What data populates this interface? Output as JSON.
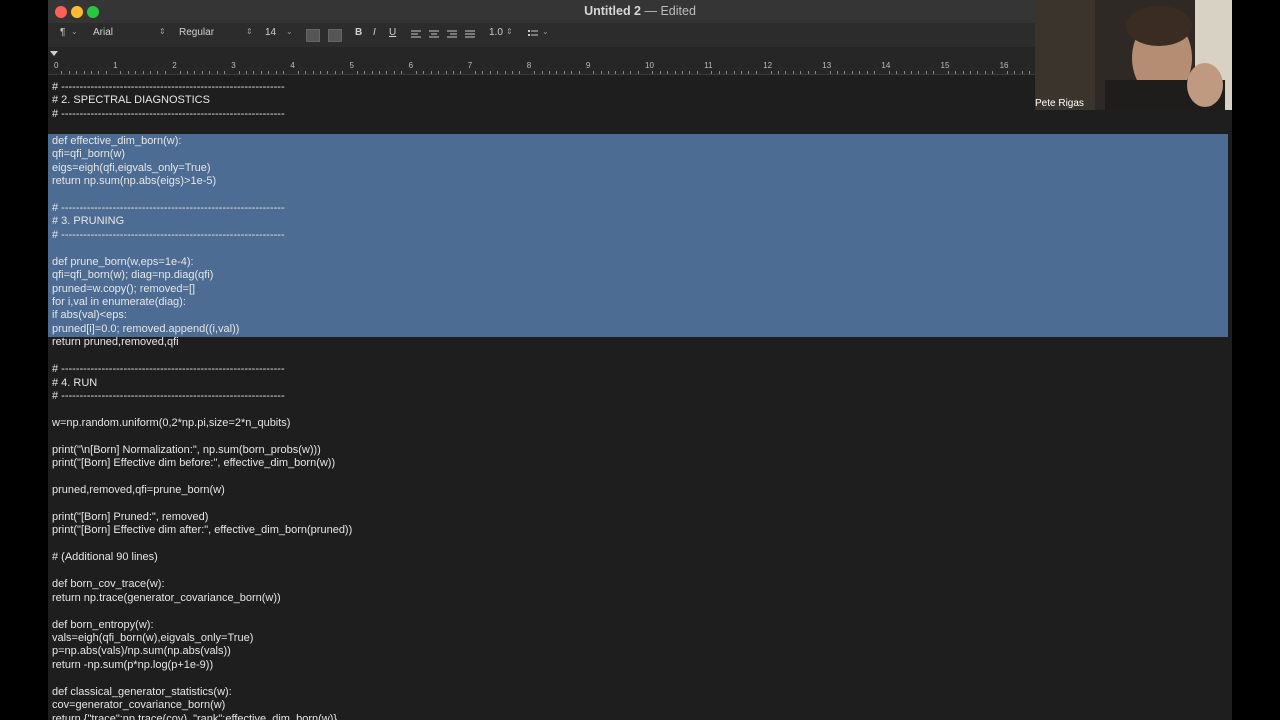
{
  "window": {
    "title": "Untitled 2",
    "subtitle": "— Edited"
  },
  "toolbar": {
    "paragraph_icon": "¶",
    "font_family": "Arial",
    "font_style": "Regular",
    "font_size": "14",
    "bold": "B",
    "italic": "I",
    "underline": "U",
    "line_spacing": "1.0"
  },
  "ruler": {
    "ticks": [
      "0",
      "1",
      "2",
      "3",
      "4",
      "5",
      "6",
      "7",
      "8",
      "9",
      "10",
      "11",
      "12",
      "13",
      "14",
      "15",
      "16"
    ]
  },
  "code_lines": [
    "# -------------------------------------------------------------",
    "# 2. SPECTRAL DIAGNOSTICS",
    "# -------------------------------------------------------------",
    "",
    "def effective_dim_born(w):",
    "qfi=qfi_born(w)",
    "eigs=eigh(qfi,eigvals_only=True)",
    "return np.sum(np.abs(eigs)>1e-5)",
    "",
    "# -------------------------------------------------------------",
    "# 3. PRUNING",
    "# -------------------------------------------------------------",
    "",
    "def prune_born(w,eps=1e-4):",
    "qfi=qfi_born(w); diag=np.diag(qfi)",
    "pruned=w.copy(); removed=[]",
    "for i,val in enumerate(diag):",
    "if abs(val)<eps:",
    "pruned[i]=0.0; removed.append((i,val))",
    "return pruned,removed,qfi",
    "",
    "# -------------------------------------------------------------",
    "# 4. RUN",
    "# -------------------------------------------------------------",
    "",
    "w=np.random.uniform(0,2*np.pi,size=2*n_qubits)",
    "",
    "print(\"\\n[Born] Normalization:\", np.sum(born_probs(w)))",
    "print(\"[Born] Effective dim before:\", effective_dim_born(w))",
    "",
    "pruned,removed,qfi=prune_born(w)",
    "",
    "print(\"[Born] Pruned:\", removed)",
    "print(\"[Born] Effective dim after:\", effective_dim_born(pruned))",
    "",
    "# (Additional 90 lines)",
    "",
    "def born_cov_trace(w):",
    "return np.trace(generator_covariance_born(w))",
    "",
    "def born_entropy(w):",
    "vals=eigh(qfi_born(w),eigvals_only=True)",
    "p=np.abs(vals)/np.sum(np.abs(vals))",
    "return -np.sum(p*np.log(p+1e-9))",
    "",
    "def classical_generator_statistics(w):",
    "cov=generator_covariance_born(w)",
    "return {\"trace\":np.trace(cov), \"rank\":effective_dim_born(w)}"
  ],
  "webcam": {
    "participant_name": "Pete Rigas"
  },
  "colors": {
    "selection": "#4d6c93",
    "background": "#1e1e1e",
    "close": "#fe5f57",
    "minimize": "#febc2e",
    "maximize": "#28c840"
  }
}
